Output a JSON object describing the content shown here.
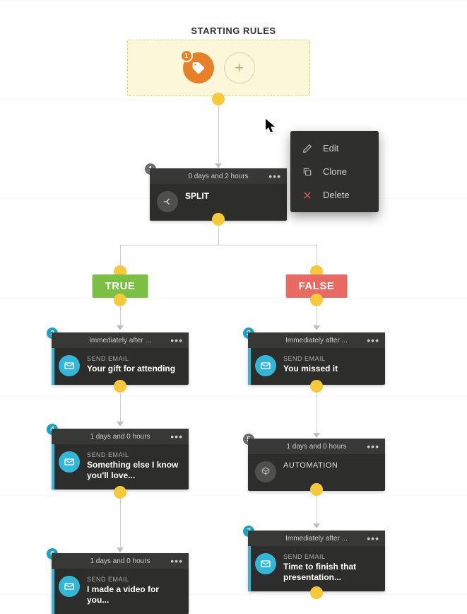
{
  "title": "STARTING RULES",
  "start": {
    "tag_count": "1"
  },
  "branches": {
    "true": "TRUE",
    "false": "FALSE"
  },
  "menu": {
    "edit": "Edit",
    "clone": "Clone",
    "delete": "Delete"
  },
  "nodes": {
    "n1": {
      "num": "1",
      "timing": "0 days and 2 hours",
      "label": "SPLIT"
    },
    "n2": {
      "num": "2",
      "timing": "Immediately after ...",
      "label": "SEND EMAIL",
      "desc": "Your gift for attending"
    },
    "n3": {
      "num": "3",
      "timing": "Immediately after ...",
      "label": "SEND EMAIL",
      "desc": "You missed it"
    },
    "n4": {
      "num": "4",
      "timing": "1 days and 0 hours",
      "label": "SEND EMAIL",
      "desc": "Something else I know you'll love..."
    },
    "n5": {
      "num": "5",
      "timing": "1 days and 0 hours",
      "label": "AUTOMATION"
    },
    "n6": {
      "num": "6",
      "timing": "1 days and 0 hours",
      "label": "SEND EMAIL",
      "desc": "I made a video for you..."
    },
    "n7": {
      "num": "7",
      "timing": "Immediately after ...",
      "label": "SEND EMAIL",
      "desc": "Time to finish that presentation..."
    }
  }
}
